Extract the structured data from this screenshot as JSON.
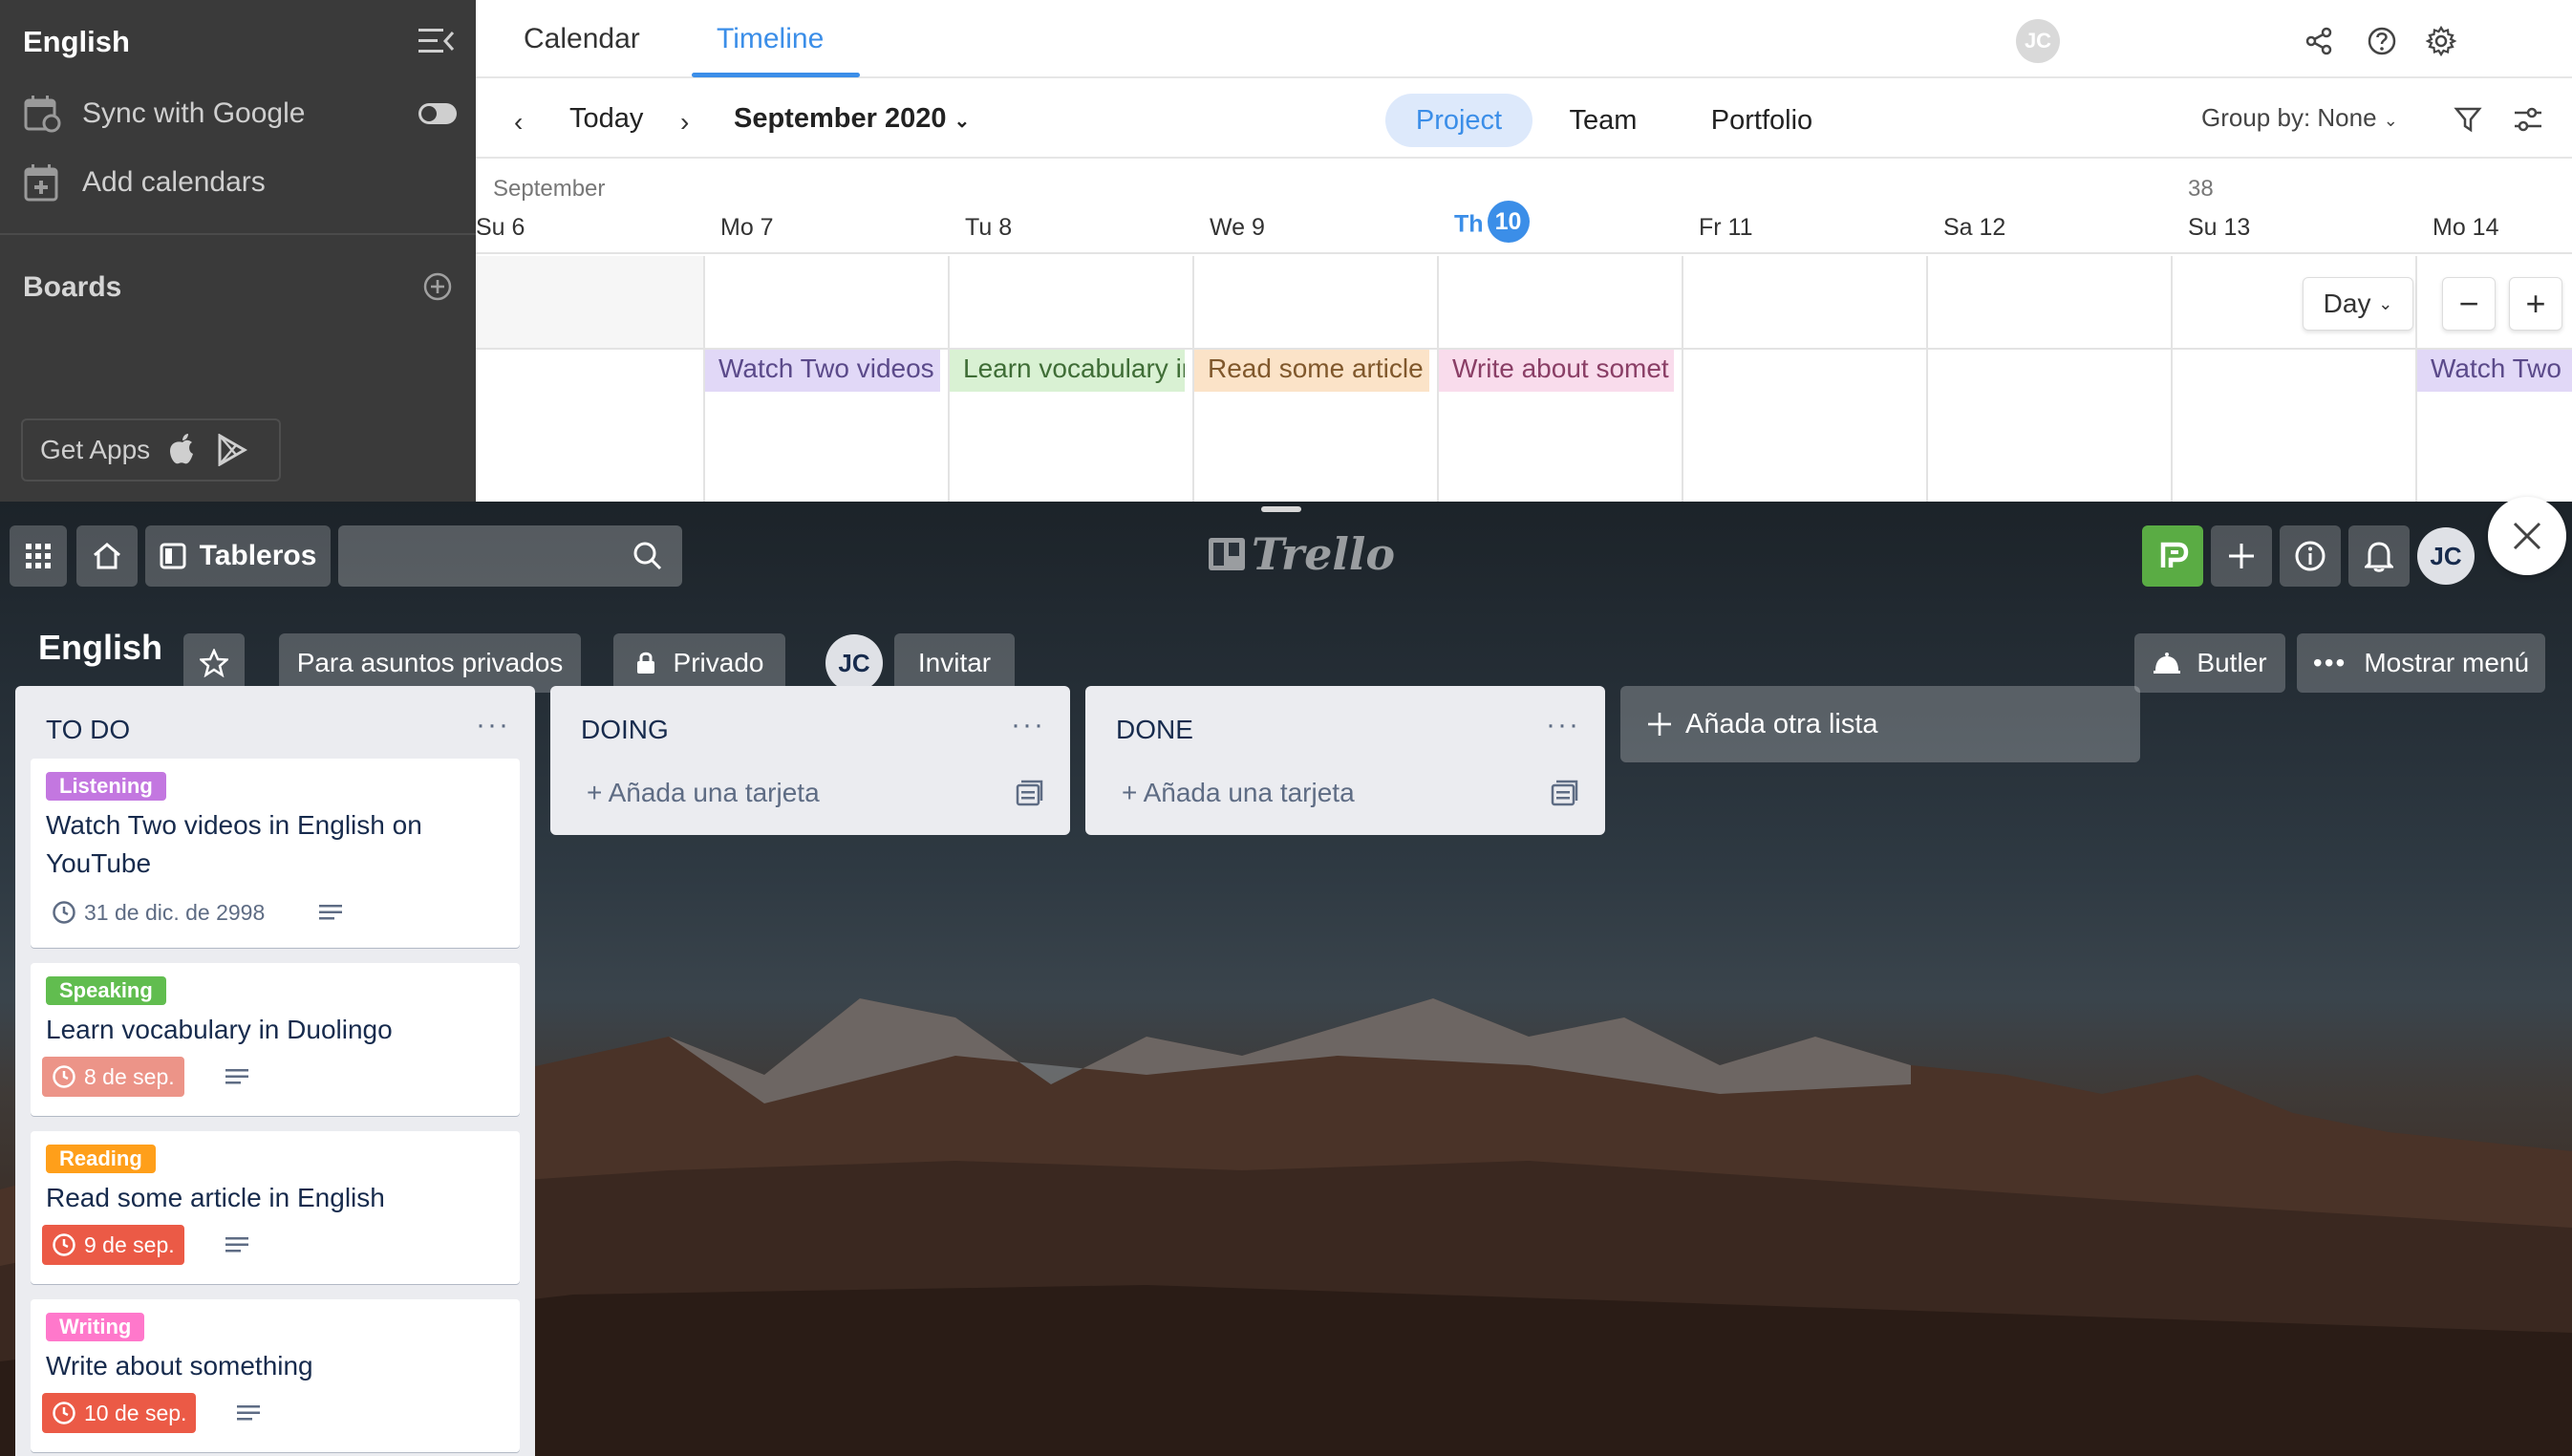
{
  "planyway": {
    "sidebar": {
      "title": "English",
      "sync_label": "Sync with Google",
      "add_calendars_label": "Add calendars",
      "boards_label": "Boards",
      "get_apps_label": "Get Apps"
    },
    "tabs": [
      {
        "label": "Calendar",
        "active": false
      },
      {
        "label": "Timeline",
        "active": true
      }
    ],
    "toolbar": {
      "today_label": "Today",
      "date_range": "September 2020",
      "views": [
        {
          "label": "Project",
          "active": true
        },
        {
          "label": "Team",
          "active": false
        },
        {
          "label": "Portfolio",
          "active": false
        }
      ],
      "group_by_label": "Group by: None"
    },
    "timeline": {
      "month_label": "September",
      "week_number": "38",
      "days": [
        {
          "name": "Su 6"
        },
        {
          "name": "Mo 7"
        },
        {
          "name": "Tu 8"
        },
        {
          "name": "We 9"
        },
        {
          "name": "Th",
          "badge": "10",
          "today": true
        },
        {
          "name": "Fr 11"
        },
        {
          "name": "Sa 12"
        },
        {
          "name": "Su 13"
        },
        {
          "name": "Mo 14"
        }
      ],
      "scale_select": "Day",
      "zoom_out": "−",
      "zoom_in": "+",
      "events": [
        {
          "title": "Watch Two videos",
          "color": "#e1d8f7",
          "text_color": "#5b4a8a"
        },
        {
          "title": "Learn vocabulary in",
          "color": "#d9f1d3",
          "text_color": "#3f6d36"
        },
        {
          "title": "Read some article",
          "color": "#fbe3c8",
          "text_color": "#80582c"
        },
        {
          "title": "Write about somet",
          "color": "#f9dcec",
          "text_color": "#8a3f66"
        },
        {
          "title": "Watch Two",
          "color": "#e1d8f7",
          "text_color": "#5b4a8a"
        }
      ]
    },
    "accent_color": "#3b8ee8",
    "user_initials": "JC"
  },
  "trello": {
    "header": {
      "boards_label": "Tableros",
      "logo_text": "Trello",
      "user_initials": "JC"
    },
    "board": {
      "title": "English",
      "workspace_label": "Para asuntos privados",
      "visibility_label": "Privado",
      "member_initials": "JC",
      "invite_label": "Invitar",
      "butler_label": "Butler",
      "menu_label": "Mostrar menú"
    },
    "lists": [
      {
        "title": "TO DO",
        "cards": [
          {
            "label": "Listening",
            "label_color": "#c377e0",
            "title_line1": "Watch Two videos in English on",
            "title_line2": "YouTube",
            "date": "31 de dic. de 2998",
            "date_style": "plain"
          },
          {
            "label": "Speaking",
            "label_color": "#61bd4f",
            "title_line1": "Learn vocabulary in Duolingo",
            "title_line2": "",
            "date": "8 de sep.",
            "date_style": "soon"
          },
          {
            "label": "Reading",
            "label_color": "#ff9f1a",
            "title_line1": "Read some article in English",
            "title_line2": "",
            "date": "9 de sep.",
            "date_style": "due"
          },
          {
            "label": "Writing",
            "label_color": "#ff78cb",
            "title_line1": "Write about something",
            "title_line2": "",
            "date": "10 de sep.",
            "date_style": "due"
          }
        ]
      },
      {
        "title": "DOING",
        "add_card_label": "Añada una tarjeta"
      },
      {
        "title": "DONE",
        "add_card_label": "Añada una tarjeta"
      }
    ],
    "add_list_label": "Añada otra lista"
  }
}
